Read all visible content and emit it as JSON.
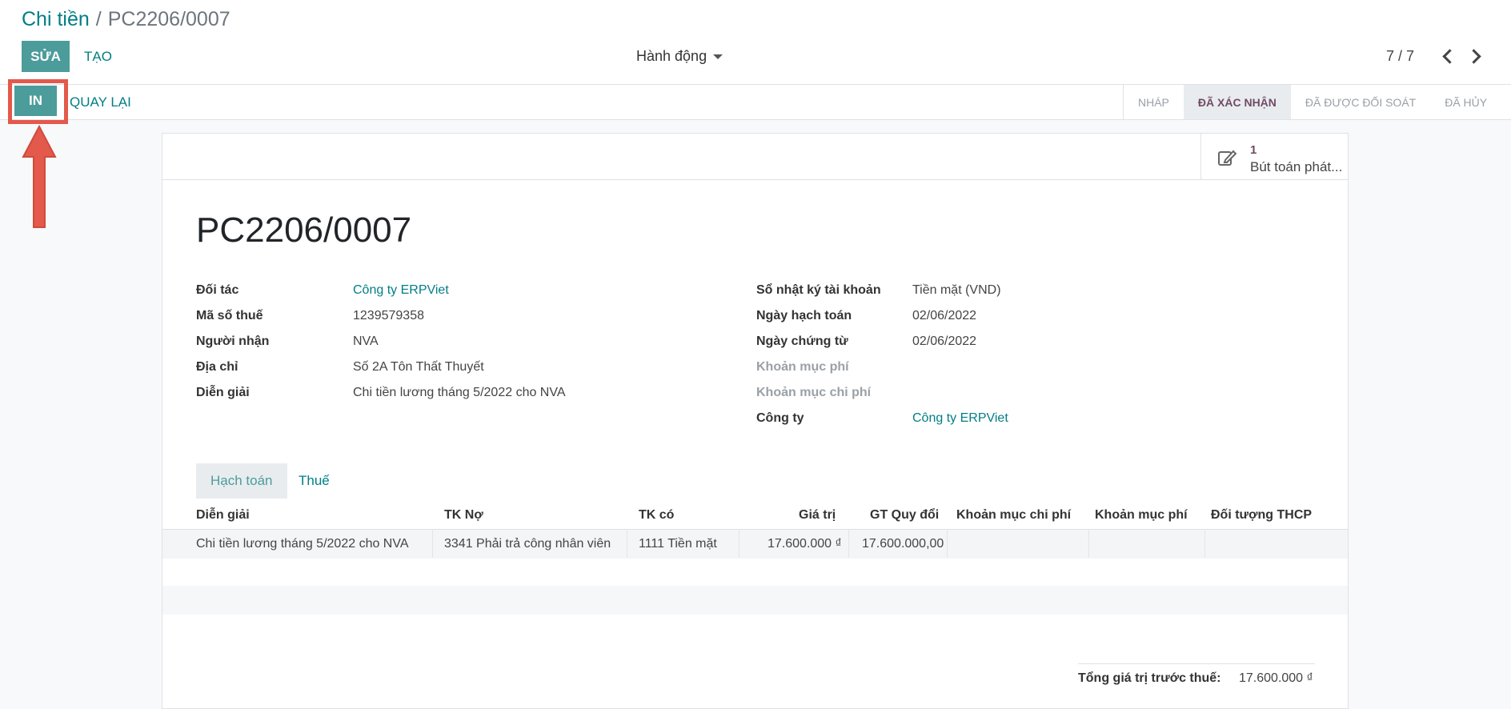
{
  "breadcrumb": {
    "parent": "Chi tiền",
    "separator": "/",
    "current": "PC2206/0007"
  },
  "toolbar": {
    "edit": "SỬA",
    "create": "TẠO",
    "action": "Hành động",
    "print": "IN",
    "back": "QUAY LẠI"
  },
  "pager": {
    "value": "7 / 7"
  },
  "status_steps": [
    {
      "label": "NHÁP",
      "active": false
    },
    {
      "label": "ĐÃ XÁC NHẬN",
      "active": true
    },
    {
      "label": "ĐÃ ĐƯỢC ĐỐI SOÁT",
      "active": false
    },
    {
      "label": "ĐÃ HỦY",
      "active": false
    }
  ],
  "stat_button": {
    "count": "1",
    "label": "Bút toán phát..."
  },
  "record": {
    "title": "PC2206/0007",
    "left_fields": [
      {
        "label": "Đối tác",
        "value": "Công ty ERPViet"
      },
      {
        "label": "Mã số thuế",
        "value": "1239579358"
      },
      {
        "label": "Người nhận",
        "value": "NVA"
      },
      {
        "label": "Địa chỉ",
        "value": "Số 2A Tôn Thất Thuyết"
      },
      {
        "label": "Diễn giải",
        "value": "Chi tiền lương tháng 5/2022 cho NVA"
      }
    ],
    "right_fields": [
      {
        "label": "Sổ nhật ký tài khoản",
        "value": "Tiền mặt (VND)"
      },
      {
        "label": "Ngày hạch toán",
        "value": "02/06/2022"
      },
      {
        "label": "Ngày chứng từ",
        "value": "02/06/2022"
      },
      {
        "label": "Khoản mục phí",
        "value": ""
      },
      {
        "label": "Khoản mục chi phí",
        "value": ""
      },
      {
        "label": "Công ty",
        "value": "Công ty ERPViet"
      }
    ]
  },
  "tabs": [
    {
      "label": "Hạch toán"
    },
    {
      "label": "Thuế"
    }
  ],
  "table": {
    "headers": [
      "Diễn giải",
      "TK Nợ",
      "TK có",
      "Giá trị",
      "GT Quy đổi",
      "Khoản mục chi phí",
      "Khoản mục phí",
      "Đối tượng THCP"
    ],
    "row": [
      "Chi tiền lương tháng 5/2022 cho NVA",
      "3341 Phải trả công nhân viên",
      "1111 Tiền mặt",
      "17.600.000 ₫",
      "17.600.000,00",
      "",
      "",
      ""
    ]
  },
  "totals": {
    "label": "Tổng giá trị trước thuế:",
    "value": "17.600.000 ₫"
  },
  "colors": {
    "primary": "#4c9c9b",
    "link": "#017e84",
    "annotation": "#e3594b",
    "status_active": "#714b67"
  }
}
